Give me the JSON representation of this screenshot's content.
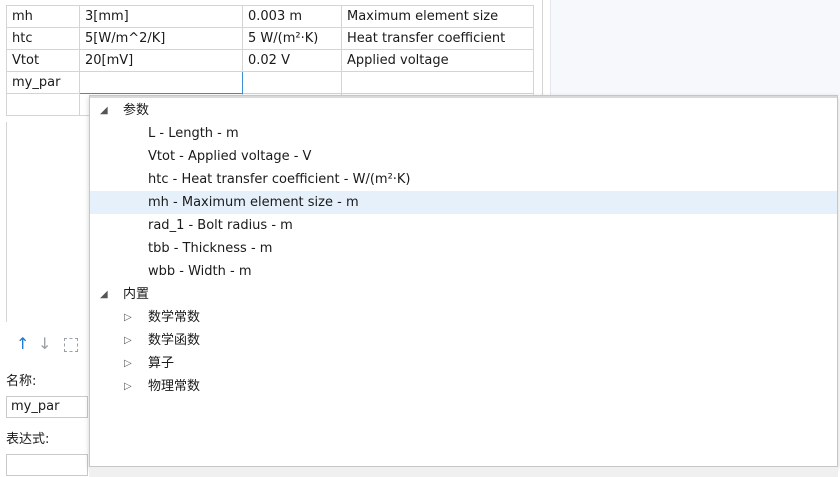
{
  "params": [
    {
      "name": "mh",
      "expr": "3[mm]",
      "value": "0.003 m",
      "desc": "Maximum element size"
    },
    {
      "name": "htc",
      "expr": "5[W/m^2/K]",
      "value": "5 W/(m²·K)",
      "desc": "Heat transfer coefficient"
    },
    {
      "name": "Vtot",
      "expr": "20[mV]",
      "value": "0.02 V",
      "desc": "Applied voltage"
    },
    {
      "name": "my_par",
      "expr": "",
      "value": "",
      "desc": ""
    }
  ],
  "settings": {
    "name_label": "名称:",
    "name_value": "my_par",
    "expr_label": "表达式:",
    "expr_value": ""
  },
  "tree": {
    "group1": {
      "label": "参数",
      "collapse_glyph": "◢"
    },
    "items": [
      "L - Length - m",
      "Vtot - Applied voltage - V",
      "htc - Heat transfer coefficient - W/(m²·K)",
      "mh - Maximum element size - m",
      "rad_1 - Bolt radius - m",
      "tbb - Thickness - m",
      "wbb - Width - m"
    ],
    "selected_index": 3,
    "group2": {
      "label": "内置",
      "collapse_glyph": "◢"
    },
    "subgroups": [
      "数学常数",
      "数学函数",
      "算子",
      "物理常数"
    ],
    "expand_glyph": "▷"
  },
  "icons": {
    "up": "↑",
    "down": "↓"
  },
  "colors": {
    "accent": "#1f78d1",
    "selection": "#e5f0fb"
  }
}
